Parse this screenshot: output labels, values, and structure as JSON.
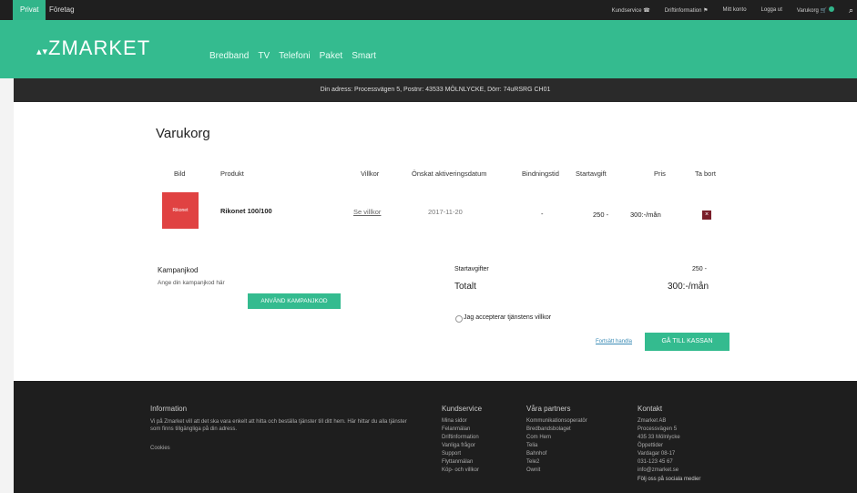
{
  "topbar": {
    "tabs": [
      "Privat",
      "Företag"
    ],
    "links": [
      "Kundservice",
      "Driftinformation",
      "Mitt konto",
      "Logga ut",
      "Varukorg"
    ]
  },
  "header": {
    "logo": "ZMARKET",
    "nav": [
      "Bredband",
      "TV",
      "Telefoni",
      "Paket",
      "Smart"
    ]
  },
  "address": "Din adress: Processvägen 5, Postnr: 43533 MÖLNLYCKE, Dörr: 74uRSRG CH01",
  "cart": {
    "title": "Varukorg",
    "columns": [
      "Bild",
      "Produkt",
      "Villkor",
      "Önskat aktiveringsdatum",
      "Bindningstid",
      "Startavgift",
      "Pris",
      "Ta bort"
    ],
    "item": {
      "image_text": "Rikonet",
      "product": "Rikonet 100/100",
      "terms": "Se villkor",
      "date": "2017-11-20",
      "binding": "-",
      "start_fee": "250 -",
      "price": "300:-/mån",
      "remove": "×"
    },
    "campaign": {
      "heading": "Kampanjkod",
      "placeholder": "Ange din kampanjkod här",
      "button": "ANVÄND KAMPANJKOD"
    },
    "summary": {
      "start_label": "Startavgifter",
      "start_value": "250 -",
      "total_label": "Totalt",
      "total_value": "300:-/mån"
    },
    "accept": "Jag accepterar tjänstens villkor",
    "continue_link": "Fortsätt handla",
    "checkout": "GÅ TILL KASSAN"
  },
  "footer": {
    "info_heading": "Information",
    "info_text": "Vi på Zmarket vill att det ska vara enkelt att hitta och beställa tjänster till ditt hem. Här hittar du alla tjänster som finns tillgängliga på din adress.",
    "cookies": "Cookies",
    "kundservice_heading": "Kundservice",
    "kundservice_items": [
      "Mina sidor",
      "Felanmälan",
      "Driftinformation",
      "Vanliga frågor",
      "Support",
      "Flyttanmälan",
      "Köp- och villkor"
    ],
    "partners_heading": "Våra partners",
    "partners_items": [
      "Kommunikationsoperatör",
      "Bredbandsbolaget",
      "Com Hem",
      "Telia",
      "Bahnhof",
      "Tele2",
      "Ownit"
    ],
    "contact_heading": "Kontakt",
    "contact_items": [
      "Zmarket AB",
      "Processvägen 5",
      "435 33 Mölnlycke",
      "Öppettider",
      "Vardagar 08-17",
      "031-123 45 67",
      "info@zmarket.se"
    ],
    "social": "Följ oss på sociala medier"
  }
}
